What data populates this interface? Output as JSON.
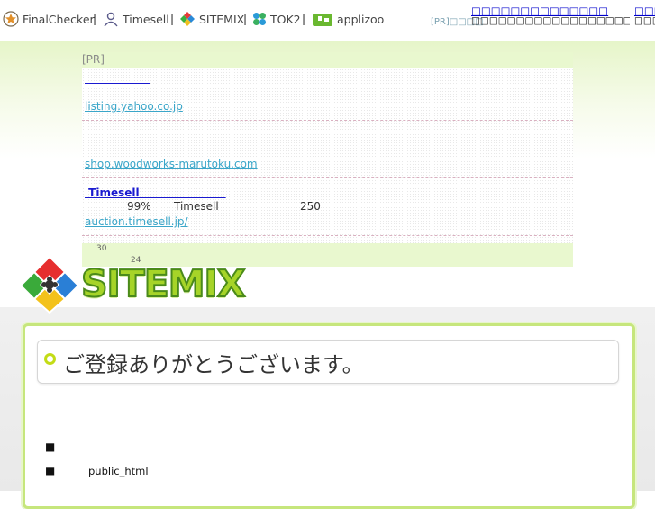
{
  "topbar": {
    "nav": [
      {
        "label": "FinalChecker",
        "icon": "star-shield-icon"
      },
      {
        "label": "Timesell",
        "icon": "person-icon"
      },
      {
        "label": "SITEMIX",
        "icon": "diamond-logo-icon"
      },
      {
        "label": "TOK2",
        "icon": "clover-icon"
      },
      {
        "label": "applizoo",
        "icon": "puzzle-icon"
      }
    ],
    "separator": "|",
    "pr_label": "[PR]□□□□",
    "pr_link_1": "□□□□□□□□□□□□□□",
    "pr_desc_1": "□□□□□□□□□□□□□□□□□□□□□□□□□□□□□□",
    "pr_link_2": "□□□□□",
    "pr_desc_2": "□□□□□"
  },
  "ads": {
    "pr_label": "[PR]",
    "items": [
      {
        "title": "　　　　　　",
        "url": "listing.yahoo.co.jp"
      },
      {
        "title": "　　　　",
        "url": "shop.woodworks-marutoku.com"
      },
      {
        "title": " Timesell　　　　　　　　",
        "body_1": "99%",
        "body_2": "Timesell",
        "body_3": "250",
        "url": "auction.timesell.jp/"
      }
    ],
    "num_1": "30",
    "num_2": "24"
  },
  "logo": {
    "text": "SITEMIX"
  },
  "main": {
    "title": "ご登録ありがとうございます。",
    "bullets": [
      {
        "symbol": "■",
        "text": ""
      },
      {
        "symbol": "■",
        "text": "public_html"
      }
    ]
  },
  "colors": {
    "accent_green": "#c6e67c",
    "link_blue": "#1a1ad0",
    "url_teal": "#3aa6c9"
  }
}
